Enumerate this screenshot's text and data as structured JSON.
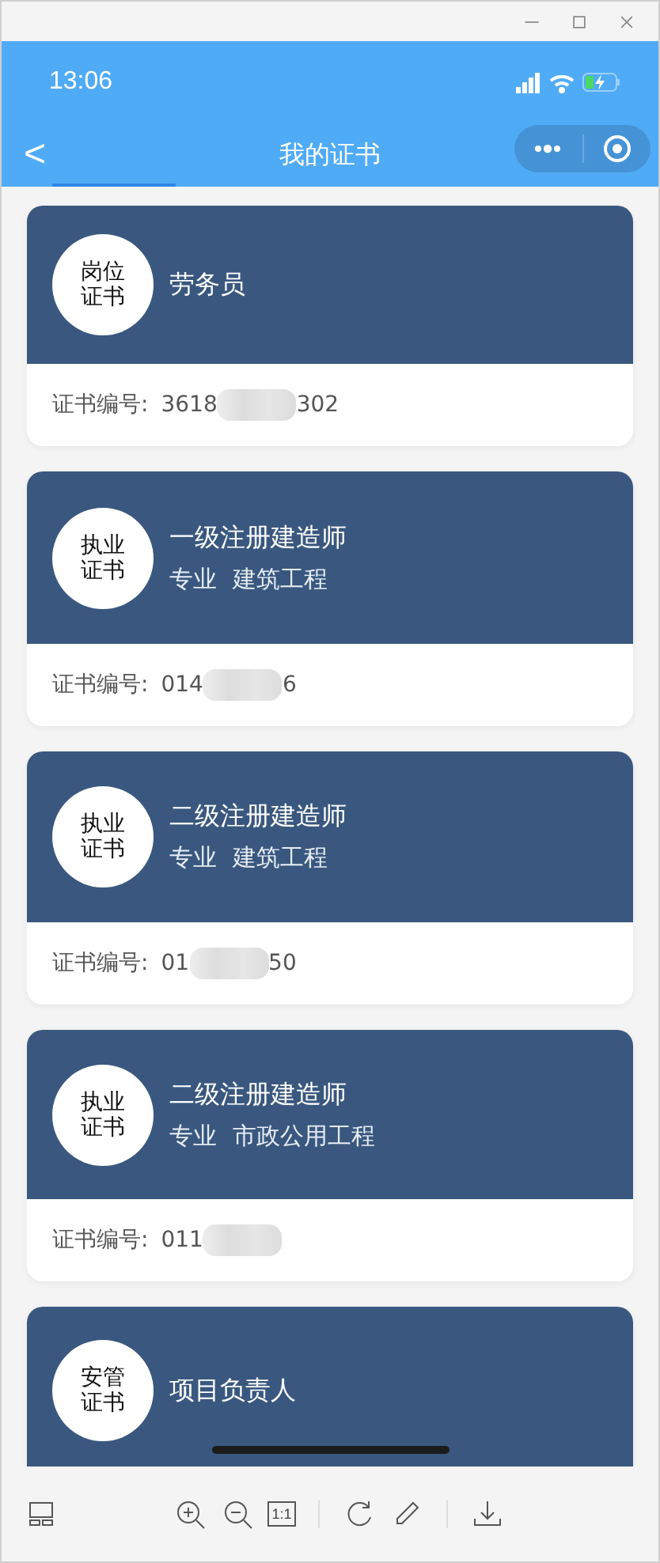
{
  "status_bar": {
    "time": "13:06"
  },
  "nav": {
    "back": "<",
    "title": "我的证书"
  },
  "certificates": [
    {
      "badge": [
        "岗位",
        "证书"
      ],
      "name": "劳务员",
      "number_label": "证书编号:",
      "number_prefix": "3618",
      "number_suffix": "302"
    },
    {
      "badge": [
        "执业",
        "证书"
      ],
      "name": "一级注册建造师",
      "specialty_label": "专业",
      "specialty": "建筑工程",
      "number_label": "证书编号:",
      "number_prefix": "014",
      "number_suffix": "6"
    },
    {
      "badge": [
        "执业",
        "证书"
      ],
      "name": "二级注册建造师",
      "specialty_label": "专业",
      "specialty": "建筑工程",
      "number_label": "证书编号:",
      "number_prefix": "01",
      "number_suffix": "50"
    },
    {
      "badge": [
        "执业",
        "证书"
      ],
      "name": "二级注册建造师",
      "specialty_label": "专业",
      "specialty": "市政公用工程",
      "number_label": "证书编号:",
      "number_prefix": "011"
    },
    {
      "badge": [
        "安管",
        "证书"
      ],
      "name": "项目负责人"
    }
  ],
  "toolbar": {
    "actual_size": "1:1"
  }
}
